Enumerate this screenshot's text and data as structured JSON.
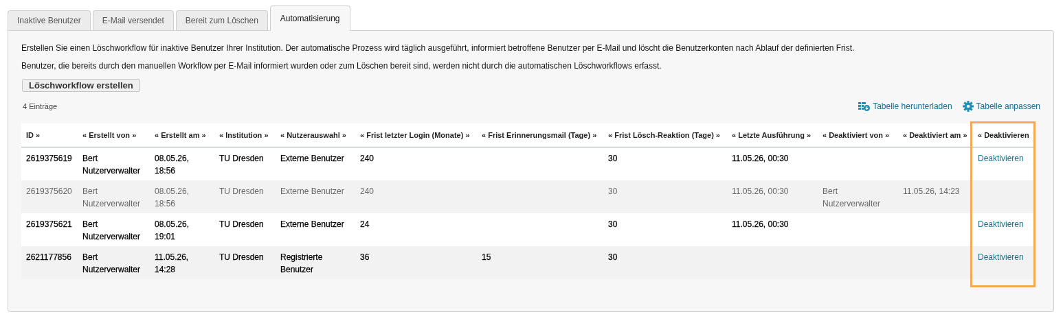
{
  "tabs": [
    {
      "label": "Inaktive Benutzer",
      "selected": false
    },
    {
      "label": "E-Mail versendet",
      "selected": false
    },
    {
      "label": "Bereit zum Löschen",
      "selected": false
    },
    {
      "label": "Automatisierung",
      "selected": true
    }
  ],
  "intro": [
    "Erstellen Sie einen Löschworkflow für inaktive Benutzer Ihrer Institution. Der automatische Prozess wird täglich ausgeführt, informiert betroffene Benutzer per E-Mail und löscht die Benutzerkonten nach Ablauf der definierten Frist.",
    "Benutzer, die bereits durch den manuellen Workflow per E-Mail informiert wurden oder zum Löschen bereit sind, werden nicht durch die automatischen Löschworkflows erfasst."
  ],
  "create_button": "Löschworkflow erstellen",
  "count": "4 Einträge",
  "table_actions": [
    {
      "kind": "download",
      "label": "Tabelle herunterladen"
    },
    {
      "kind": "settings",
      "label": "Tabelle anpassen"
    }
  ],
  "table": {
    "columns": [
      {
        "label": "ID »",
        "highlighted": false
      },
      {
        "label": "«  Erstellt von »",
        "highlighted": false
      },
      {
        "label": "«  Erstellt am »",
        "highlighted": false
      },
      {
        "label": "«  Institution »",
        "highlighted": false
      },
      {
        "label": "«  Nutzerauswahl »",
        "highlighted": false
      },
      {
        "label": "«  Frist letzter Login (Monate) »",
        "highlighted": false
      },
      {
        "label": "«  Frist Erinnerungsmail (Tage) »",
        "highlighted": false
      },
      {
        "label": "«  Frist Lösch-Reaktion (Tage) »",
        "highlighted": false
      },
      {
        "label": "«  Letzte Ausführung »",
        "highlighted": false
      },
      {
        "label": "«  Deaktiviert von »",
        "highlighted": false
      },
      {
        "label": "«  Deaktiviert am »",
        "highlighted": false
      },
      {
        "label": "«  Deaktivieren",
        "highlighted": true
      }
    ],
    "rows": [
      {
        "deactivated": false,
        "cells": [
          "2619375619",
          "Bert Nutzerverwalter",
          "08.05.26, 18:56",
          "TU Dresden",
          "Externe Benutzer",
          "240",
          null,
          "30",
          "11.05.26, 00:30",
          null,
          null
        ],
        "action": "Deaktivieren"
      },
      {
        "deactivated": true,
        "cells": [
          "2619375620",
          "Bert Nutzerverwalter",
          "08.05.26, 18:56",
          "TU Dresden",
          "Externe Benutzer",
          "240",
          null,
          "30",
          "11.05.26, 00:30",
          "Bert Nutzerverwalter",
          "11.05.26, 14:23"
        ],
        "action": null
      },
      {
        "deactivated": false,
        "cells": [
          "2619375621",
          "Bert Nutzerverwalter",
          "08.05.26, 19:01",
          "TU Dresden",
          "Externe Benutzer",
          "24",
          null,
          "30",
          "11.05.26, 00:30",
          null,
          null
        ],
        "action": "Deaktivieren"
      },
      {
        "deactivated": false,
        "cells": [
          "2621177856",
          "Bert Nutzerverwalter",
          "11.05.26, 14:28",
          "TU Dresden",
          "Registrierte Benutzer",
          "36",
          "15",
          "30",
          null,
          null,
          null
        ],
        "action": "Deaktivieren"
      }
    ]
  }
}
